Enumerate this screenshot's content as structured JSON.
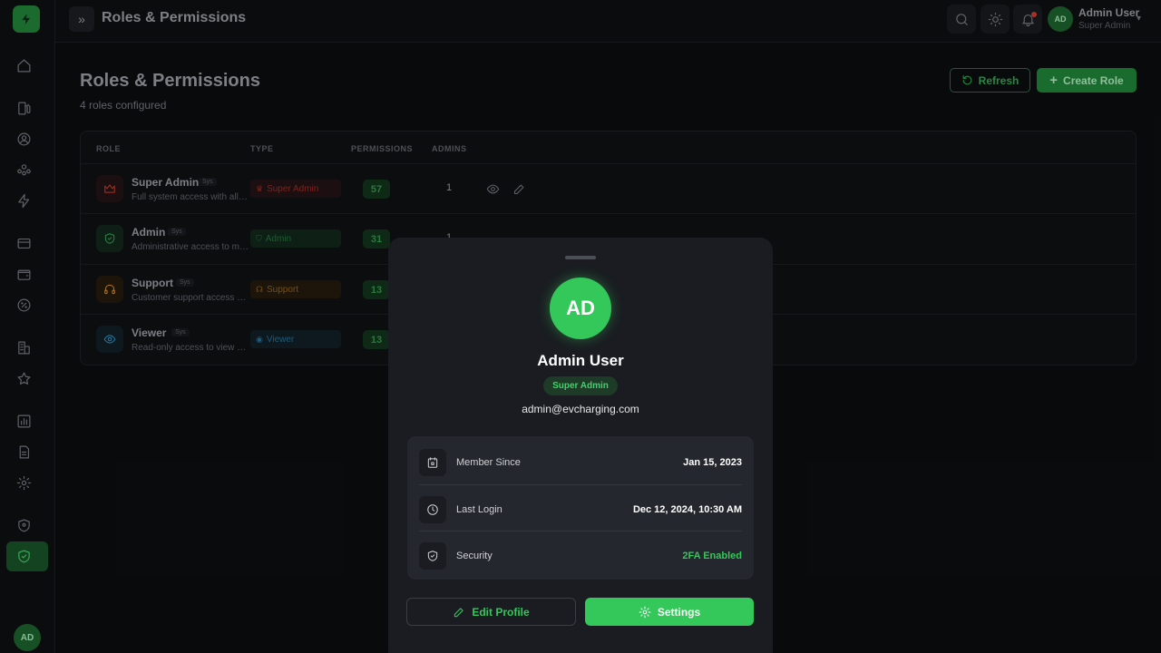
{
  "header": {
    "title": "Roles & Permissions",
    "user_name": "Admin User",
    "user_role": "Super Admin",
    "user_initials": "AD"
  },
  "sidebar": {
    "avatar_initials": "AD",
    "items": [
      {
        "icon": "home-icon"
      },
      {
        "icon": "fuel-station-icon"
      },
      {
        "icon": "user-circle-icon"
      },
      {
        "icon": "users-group-icon"
      },
      {
        "icon": "lightning-icon"
      },
      {
        "icon": "credit-card-icon"
      },
      {
        "icon": "wallet-icon"
      },
      {
        "icon": "discount-icon"
      },
      {
        "icon": "building-icon"
      },
      {
        "icon": "star-icon"
      },
      {
        "icon": "bar-chart-icon"
      },
      {
        "icon": "document-icon"
      },
      {
        "icon": "gear-icon"
      },
      {
        "icon": "shield-user-icon"
      },
      {
        "icon": "shield-check-icon",
        "active": true
      }
    ]
  },
  "page": {
    "title": "Roles & Permissions",
    "subtitle": "4 roles configured",
    "refresh_label": "Refresh",
    "create_label": "Create Role"
  },
  "table": {
    "columns": [
      "ROLE",
      "TYPE",
      "PERMISSIONS",
      "ADMINS"
    ],
    "rows": [
      {
        "name": "Super Admin",
        "tag": "Sys",
        "desc": "Full system access with all permissions",
        "type": "Super Admin",
        "permissions": "57",
        "admins": "1",
        "color": "#c0392b"
      },
      {
        "name": "Admin",
        "tag": "Sys",
        "desc": "Administrative access to manage",
        "type": "Admin",
        "permissions": "31",
        "admins": "1",
        "color": "#2a9d4a"
      },
      {
        "name": "Support",
        "tag": "Sys",
        "desc": "Customer support access with",
        "type": "Support",
        "permissions": "13",
        "admins": "",
        "color": "#d4861f"
      },
      {
        "name": "Viewer",
        "tag": "Sys",
        "desc": "Read-only access to view data",
        "type": "Viewer",
        "permissions": "13",
        "admins": "",
        "color": "#2a8fc0"
      }
    ]
  },
  "profile": {
    "initials": "AD",
    "name": "Admin User",
    "role": "Super Admin",
    "email": "admin@evcharging.com",
    "info": [
      {
        "label": "Member Since",
        "value": "Jan 15, 2023",
        "icon": "calendar-icon"
      },
      {
        "label": "Last Login",
        "value": "Dec 12, 2024, 10:30 AM",
        "icon": "clock-icon"
      },
      {
        "label": "Security",
        "value": "2FA Enabled",
        "icon": "shield-icon"
      }
    ],
    "edit_label": "Edit Profile",
    "settings_label": "Settings"
  },
  "colors": {
    "accent": "#34c759",
    "background": "#0b0c0e",
    "sheet": "#1a1c21"
  }
}
